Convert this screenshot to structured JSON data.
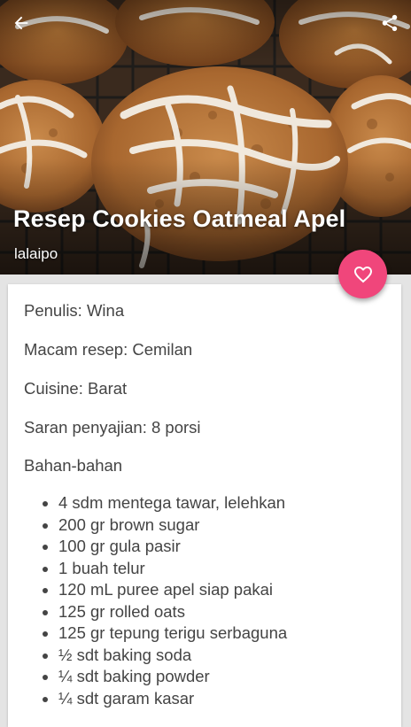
{
  "header": {
    "title": "Resep Cookies Oatmeal Apel",
    "author": "lalaipo",
    "icons": {
      "back": "arrow-left-icon",
      "share": "share-icon",
      "favorite": "heart-outline-icon"
    },
    "accent_color": "#f0467b"
  },
  "recipe": {
    "penulis": "Penulis: Wina",
    "macam_resep": "Macam resep: Cemilan",
    "cuisine": "Cuisine: Barat",
    "saran_penyajian": "Saran penyajian: 8 porsi",
    "bahan_heading": "Bahan-bahan",
    "ingredients": [
      "4 sdm mentega tawar, lelehkan",
      "200 gr brown sugar",
      "100 gr gula pasir",
      "1 buah telur",
      "120 mL puree apel siap pakai",
      "125 gr rolled oats",
      "125 gr tepung terigu serbaguna",
      "½ sdt baking soda",
      "¼ sdt baking powder",
      "¼ sdt garam kasar"
    ]
  }
}
